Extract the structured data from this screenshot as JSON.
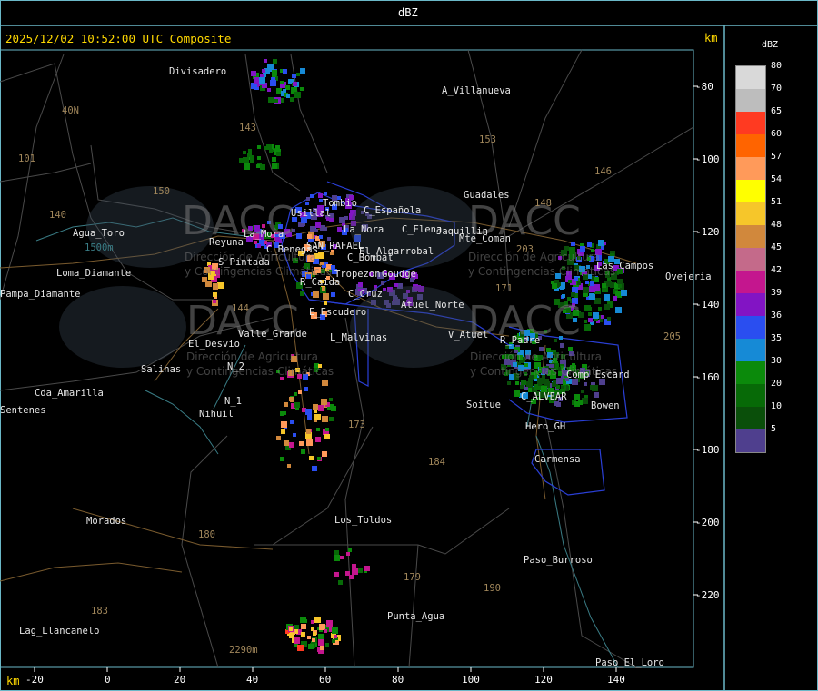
{
  "header": {
    "title": "dBZ"
  },
  "map": {
    "timestamp": "2025/12/02 10:52:00 UTC Composite",
    "km_label_top": "km",
    "km_label_bottom": "km",
    "y_ticks": [
      "-80",
      "-100",
      "-120",
      "-140",
      "-160",
      "-180",
      "-200",
      "-220"
    ],
    "x_ticks": [
      "-20",
      "0",
      "20",
      "40",
      "60",
      "80",
      "100",
      "120",
      "140"
    ],
    "places": [
      "Divisadero",
      "A_Villanueva",
      "Guadales",
      "Usillal",
      "Tombio",
      "C_Española",
      "La_Nora",
      "C_Elena",
      "Jaquillin",
      "Agua_Toro",
      "Reyuna",
      "La_Mora",
      "C_Benegas",
      "SAN_RAFAEL",
      "El_Algarrobal",
      "C_Bombal",
      "Goudge",
      "Ovejeria",
      "Pampa_Diamante",
      "S_Pintada",
      "Tropezon",
      "R_Caida",
      "C_Cruz",
      "Atuel_Norte",
      "E_Escudero",
      "V_Atuel",
      "R_Padre",
      "El_Desvio",
      "Valle_Grande",
      "L_Malvinas",
      "Salinas",
      "Cda_Amarilla",
      "N_2",
      "N_1",
      "Nihuil",
      "Soitue",
      "C_ALVEAR",
      "Bowen",
      "Comp_Escard",
      "Hero_GH",
      "Carmensa",
      "Morados",
      "Los_Toldos",
      "Paso_Burroso",
      "Punta_Agua",
      "Lag_Llancanelo",
      "Paso_El_Loro",
      "Las_Campos",
      "Sentenes",
      "Mte_Coman",
      "Loma_Diamante"
    ],
    "roads": [
      "40N",
      "101",
      "153",
      "150",
      "146",
      "143",
      "148",
      "171",
      "203",
      "140",
      "184",
      "205",
      "180",
      "173",
      "179",
      "190",
      "183",
      "144"
    ],
    "heights": [
      "1500m",
      "2290m"
    ],
    "watermark": {
      "logo_text": "DACC",
      "line1": "Dirección de Agricultura",
      "line2": "y Contingencias Climáticas"
    }
  },
  "legend": {
    "title": "dBZ",
    "levels": [
      {
        "value": "80",
        "color": "#d9d9d9"
      },
      {
        "value": "70",
        "color": "#bdbdbd"
      },
      {
        "value": "65",
        "color": "#ff3a21"
      },
      {
        "value": "60",
        "color": "#ff6400"
      },
      {
        "value": "57",
        "color": "#ff9a5a"
      },
      {
        "value": "54",
        "color": "#ffff00"
      },
      {
        "value": "51",
        "color": "#f6c62a"
      },
      {
        "value": "48",
        "color": "#d1883c"
      },
      {
        "value": "45",
        "color": "#c46a8a"
      },
      {
        "value": "42",
        "color": "#c4168e"
      },
      {
        "value": "39",
        "color": "#8214c4"
      },
      {
        "value": "36",
        "color": "#2a4ef0"
      },
      {
        "value": "35",
        "color": "#168ad6"
      },
      {
        "value": "30",
        "color": "#0b8a0b"
      },
      {
        "value": "20",
        "color": "#076a07"
      },
      {
        "value": "10",
        "color": "#0a4f0a"
      },
      {
        "value": "5",
        "color": "#4f3f8e"
      }
    ]
  }
}
